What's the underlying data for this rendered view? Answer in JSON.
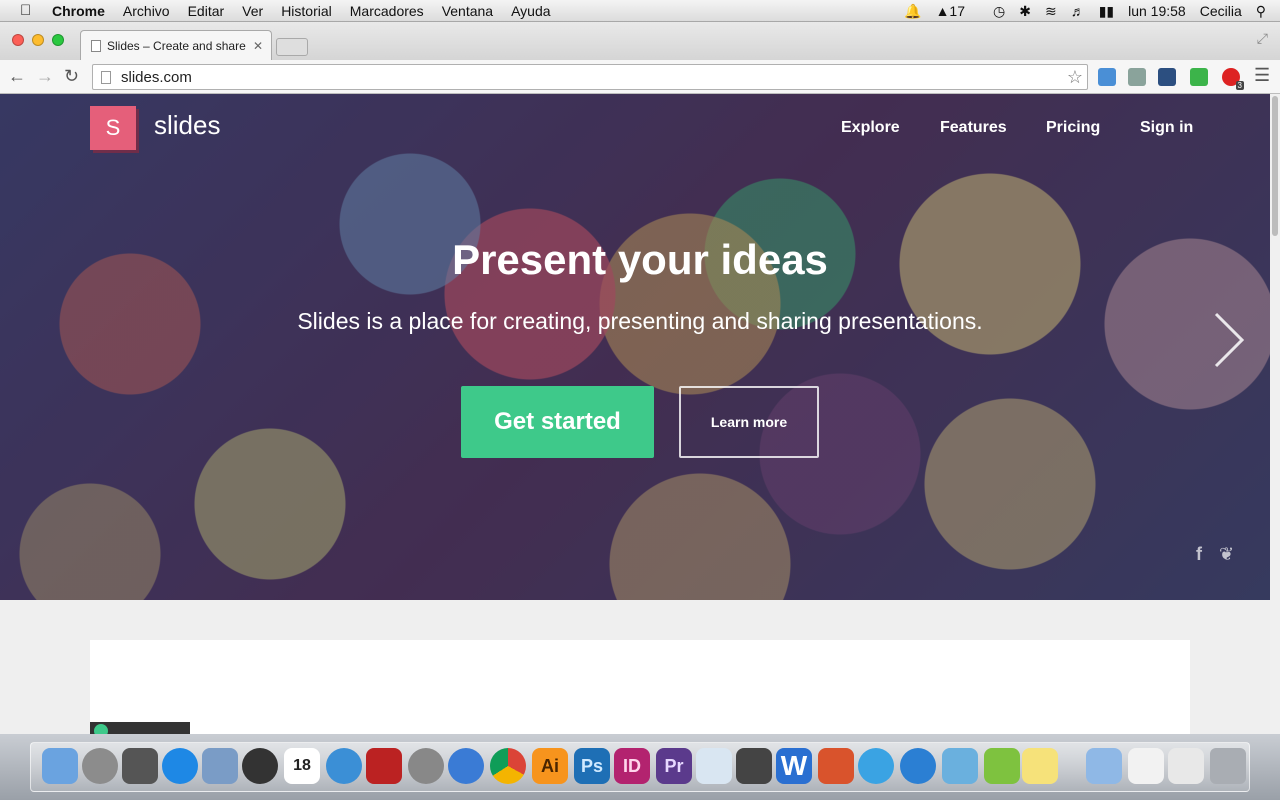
{
  "menubar": {
    "app": "Chrome",
    "items": [
      "Archivo",
      "Editar",
      "Ver",
      "Historial",
      "Marcadores",
      "Ventana",
      "Ayuda"
    ],
    "adobe_count": "17",
    "clock": "lun 19:58",
    "user": "Cecilia"
  },
  "browser": {
    "tab_title": "Slides – Create and share p",
    "url": "slides.com",
    "extension_badge": "3"
  },
  "site": {
    "logo_letter": "S",
    "brand": "slides",
    "nav": [
      "Explore",
      "Features",
      "Pricing",
      "Sign in"
    ],
    "headline": "Present your ideas",
    "subheadline": "Slides is a place for creating, presenting and sharing presentations.",
    "cta": "Get started",
    "secondary": "Learn more",
    "social": [
      "f",
      "twitter"
    ]
  },
  "dock": {
    "calendar_day": "18",
    "labels": [
      "Ai",
      "Ps",
      "ID",
      "Pr",
      "W"
    ]
  },
  "colors": {
    "accent": "#3ec98a",
    "logo": "#e55f7a"
  }
}
